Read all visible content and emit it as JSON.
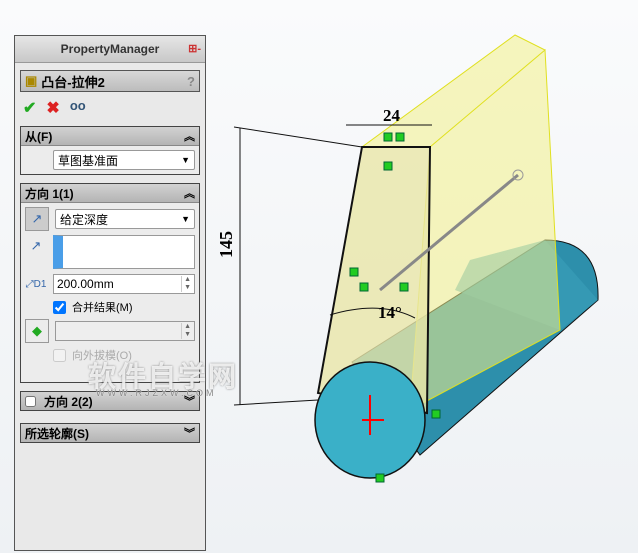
{
  "property_manager": {
    "title": "PropertyManager",
    "feature_name": "凸台-拉伸2",
    "help": "?",
    "ok": "✔",
    "cancel": "✖",
    "preview": "👓",
    "from": {
      "label": "从(F)",
      "value": "草图基准面"
    },
    "direction1": {
      "label": "方向 1(1)",
      "end_condition": "给定深度",
      "depth": "200.00mm",
      "merge_label": "合并结果(M)",
      "merge_checked": true,
      "draft_label": "向外拔模(O)"
    },
    "direction2": {
      "label": "方向 2(2)"
    },
    "contours": {
      "label": "所选轮廓(S)"
    }
  },
  "dimensions": {
    "width": "24",
    "height": "145",
    "angle": "14°"
  },
  "watermark": {
    "title": "软件自学网",
    "url": "WWW.RJZXW.COM"
  },
  "colors": {
    "cylinder": "#3aa9c4",
    "extrude": "#f2f08a",
    "sketch": "#000000"
  }
}
